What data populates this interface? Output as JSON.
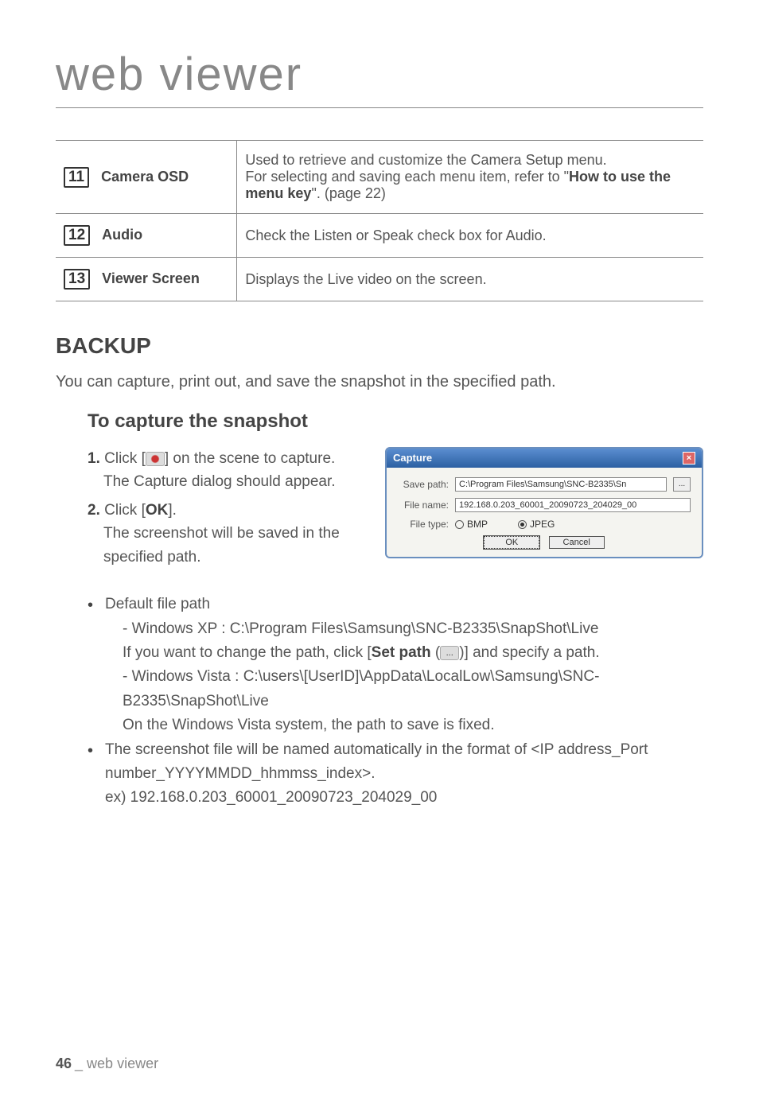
{
  "chapter_title": "web viewer",
  "table": {
    "rows": [
      {
        "num": "11",
        "label": "Camera OSD",
        "desc_line1": "Used to retrieve and customize the Camera Setup menu.",
        "desc_line2_prefix": "For selecting and saving each menu item, refer to \"",
        "desc_line2_bold": "How to use the menu key",
        "desc_line2_suffix": "\". (page 22)"
      },
      {
        "num": "12",
        "label": "Audio",
        "desc": "Check the Listen or Speak check box for Audio."
      },
      {
        "num": "13",
        "label": "Viewer Screen",
        "desc": "Displays the Live video on the screen."
      }
    ]
  },
  "backup": {
    "heading": "BACKUP",
    "intro": "You can capture, print out, and save the snapshot in the specified path.",
    "subheading": "To capture the snapshot",
    "steps": [
      {
        "num": "1.",
        "pre": "Click [",
        "post": "] on the scene to capture.",
        "line2": "The Capture dialog should appear."
      },
      {
        "num": "2.",
        "pre": "Click [",
        "bold": "OK",
        "post": "].",
        "line2": "The screenshot will be saved in the specified path."
      }
    ],
    "dialog": {
      "title": "Capture",
      "save_path_label": "Save path:",
      "save_path_value": "C:\\Program Files\\Samsung\\SNC-B2335\\Sn",
      "browse": "...",
      "file_name_label": "File name:",
      "file_name_value": "192.168.0.203_60001_20090723_204029_00",
      "file_type_label": "File type:",
      "opt_bmp": "BMP",
      "opt_jpeg": "JPEG",
      "ok": "OK",
      "cancel": "Cancel"
    },
    "bullets": {
      "b1": "Default file path",
      "b1_sub1_line1": "Windows XP : C:\\Program Files\\Samsung\\SNC-B2335\\SnapShot\\Live",
      "b1_sub1_line2_pre": "If you want to change the path, click [",
      "b1_sub1_line2_bold": "Set path",
      "b1_sub1_line2_mid": " (",
      "b1_sub1_line2_post": ")] and specify a path.",
      "b1_sub2_line1": "Windows Vista : C:\\users\\[UserID]\\AppData\\LocalLow\\Samsung\\SNC-B2335\\SnapShot\\Live",
      "b1_sub2_line2": "On the Windows Vista system, the path to save is fixed.",
      "b2_line1": "The screenshot file will be named automatically in the format of <IP address_Port number_YYYYMMDD_hhmmss_index>.",
      "b2_line2": "ex) 192.168.0.203_60001_20090723_204029_00"
    }
  },
  "footer": {
    "page": "46",
    "label": "_ web viewer"
  }
}
